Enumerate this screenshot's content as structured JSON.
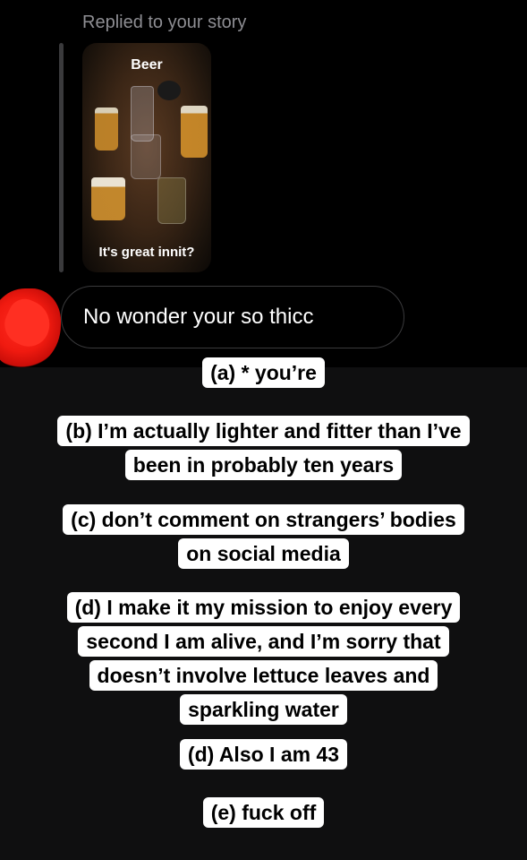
{
  "reply": {
    "header": "Replied to your story"
  },
  "story": {
    "title": "Beer",
    "caption": "It's great innit?"
  },
  "message": {
    "text": "No wonder your so thicc",
    "emoji": "😂"
  },
  "captions": [
    {
      "lines": [
        "(a) * you’re"
      ]
    },
    {
      "lines": [
        "(b) I’m actually lighter and fitter than I’ve",
        "been in probably ten years"
      ]
    },
    {
      "lines": [
        "(c) don’t comment on strangers’ bodies",
        "on social media"
      ]
    },
    {
      "lines": [
        "(d) I make it my mission to enjoy every",
        "second I am alive, and I’m sorry that",
        "doesn’t involve lettuce leaves and",
        "sparkling water"
      ]
    },
    {
      "lines": [
        "(d) Also I am 43"
      ]
    },
    {
      "lines": [
        "(e) fuck off"
      ]
    }
  ],
  "colors": {
    "background_top": "#000000",
    "background_bottom": "#0f0f10",
    "caption_bg": "#ffffff",
    "sticker_red": "#f01a10"
  }
}
